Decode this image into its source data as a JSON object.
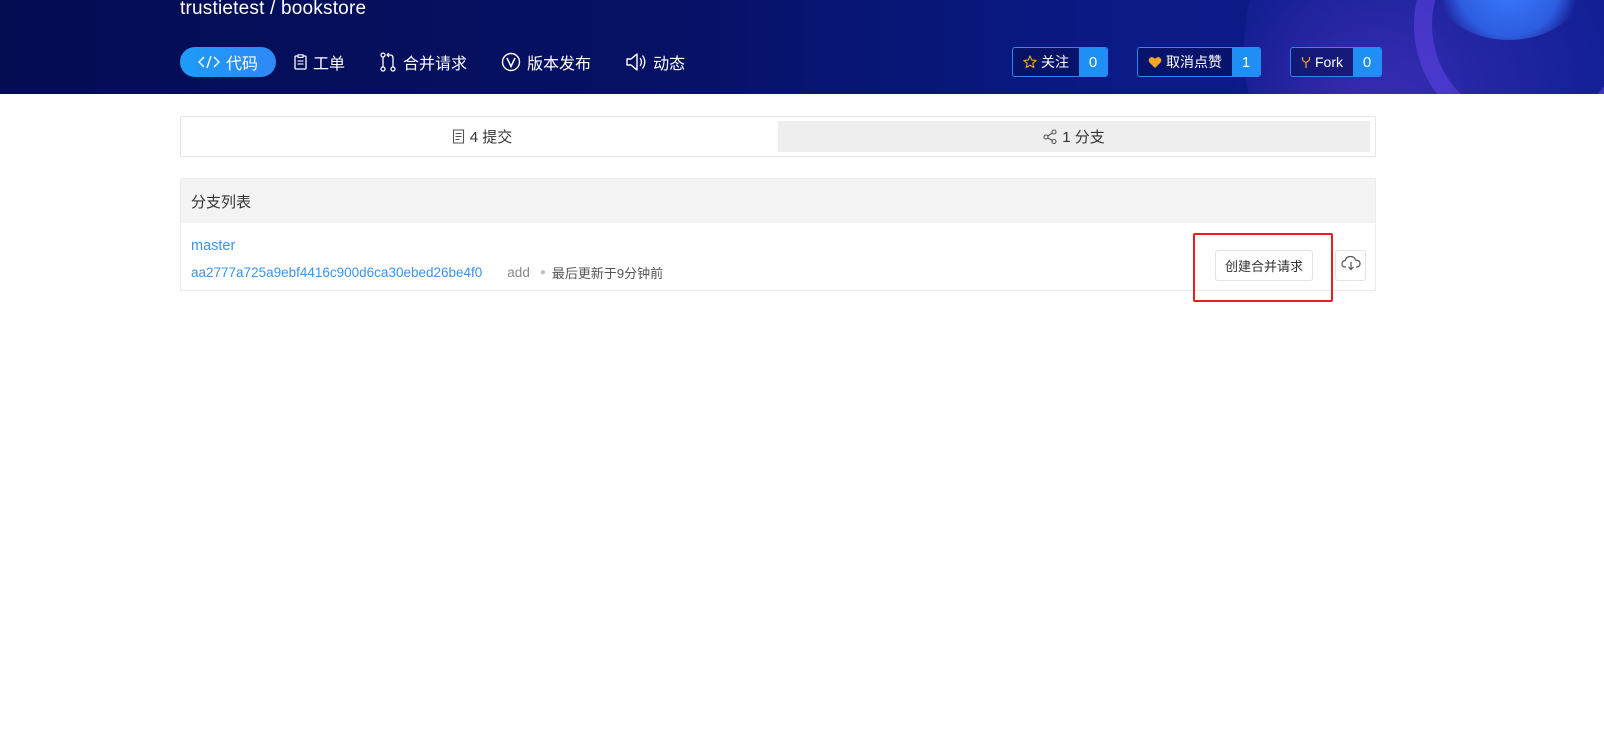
{
  "repo": {
    "title": "trustietest / bookstore"
  },
  "nav": {
    "tabs": [
      {
        "label": "代码",
        "icon": "code-icon"
      },
      {
        "label": "工单",
        "icon": "clipboard-icon"
      },
      {
        "label": "合并请求",
        "icon": "pull-request-icon"
      },
      {
        "label": "版本发布",
        "icon": "version-icon"
      },
      {
        "label": "动态",
        "icon": "speaker-icon"
      }
    ]
  },
  "stats": {
    "watch": {
      "label": "关注",
      "count": "0",
      "icon": "star-icon"
    },
    "like": {
      "label": "取消点赞",
      "count": "1",
      "icon": "heart-icon"
    },
    "fork": {
      "label": "Fork",
      "count": "0",
      "icon": "fork-icon"
    }
  },
  "summary": {
    "commits": "4 提交",
    "branches": "1 分支"
  },
  "branches": {
    "header": "分支列表",
    "items": [
      {
        "name": "master",
        "sha": "aa2777a725a9ebf4416c900d6ca30ebed26be4f0",
        "message": "add",
        "updated": "最后更新于9分钟前",
        "pr_button": "创建合并请求"
      }
    ]
  },
  "colors": {
    "accent": "#1f8ff6",
    "link": "#3b93ee",
    "header_bg": "#061164",
    "highlight": "#ee1d1d",
    "heart": "#f5a623",
    "star": "#f5a623"
  }
}
